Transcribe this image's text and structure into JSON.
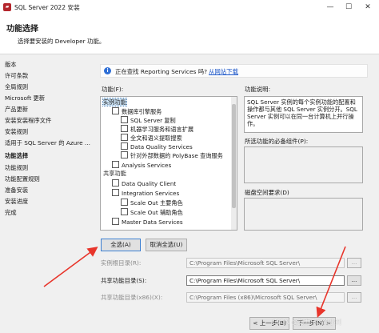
{
  "window": {
    "title": "SQL Server 2022 安装",
    "minimize": "—",
    "maximize": "☐",
    "close": "✕",
    "app_icon": "sql-server-icon"
  },
  "header": {
    "title": "功能选择",
    "subtitle": "选择要安装的 Developer 功能。"
  },
  "sidebar": {
    "items": [
      {
        "label": "版本",
        "active": false
      },
      {
        "label": "许可条款",
        "active": false
      },
      {
        "label": "全局规则",
        "active": false
      },
      {
        "label": "Microsoft 更新",
        "active": false
      },
      {
        "label": "产品更新",
        "active": false
      },
      {
        "label": "安装安装程序文件",
        "active": false
      },
      {
        "label": "安装规则",
        "active": false
      },
      {
        "label": "适用于 SQL Server 的 Azure ...",
        "active": false
      },
      {
        "label": "功能选择",
        "active": true
      },
      {
        "label": "功能规则",
        "active": false
      },
      {
        "label": "功能配置规则",
        "active": false
      },
      {
        "label": "准备安装",
        "active": false
      },
      {
        "label": "安装进度",
        "active": false
      },
      {
        "label": "完成",
        "active": false
      }
    ]
  },
  "info_bar": {
    "icon": "info-icon",
    "text": "正在查找 Reporting Services 吗?",
    "link": "从网站下载"
  },
  "features": {
    "label": "功能(F):",
    "tree": [
      {
        "label": "实例功能",
        "level": 0,
        "checkbox": false,
        "selected": true
      },
      {
        "label": "数据库引擎服务",
        "level": 1,
        "checkbox": true,
        "selected": false
      },
      {
        "label": "SQL Server 复制",
        "level": 2,
        "checkbox": true,
        "selected": false
      },
      {
        "label": "机器学习服务和语言扩展",
        "level": 2,
        "checkbox": true,
        "selected": false
      },
      {
        "label": "全文和语义提取搜索",
        "level": 2,
        "checkbox": true,
        "selected": false
      },
      {
        "label": "Data Quality Services",
        "level": 2,
        "checkbox": true,
        "selected": false
      },
      {
        "label": "针对外部数据的 PolyBase 查询服务",
        "level": 2,
        "checkbox": true,
        "selected": false
      },
      {
        "label": "Analysis Services",
        "level": 1,
        "checkbox": true,
        "selected": false
      },
      {
        "label": "共享功能",
        "level": 0,
        "checkbox": false,
        "selected": false
      },
      {
        "label": "Data Quality Client",
        "level": 1,
        "checkbox": true,
        "selected": false
      },
      {
        "label": "Integration Services",
        "level": 1,
        "checkbox": true,
        "selected": false
      },
      {
        "label": "Scale Out 主要角色",
        "level": 2,
        "checkbox": true,
        "selected": false
      },
      {
        "label": "Scale Out 辅助角色",
        "level": 2,
        "checkbox": true,
        "selected": false
      },
      {
        "label": "Master Data Services",
        "level": 1,
        "checkbox": true,
        "selected": false
      }
    ]
  },
  "description": {
    "label": "功能说明:",
    "text": "SQL Server 实例的每个实例功能的配置和操作都与其他 SQL Server 实例分开。SQL Server 实例可以在同一台计算机上并行操作。"
  },
  "prereq": {
    "label": "所选功能的必备组件(P):"
  },
  "disk": {
    "label": "磁盘空间要求(D)"
  },
  "buttons": {
    "select_all": "全选(A)",
    "unselect_all": "取消全选(U)"
  },
  "paths": {
    "instance_root": {
      "label": "实例根目录(R):",
      "value": "C:\\Program Files\\Microsoft SQL Server\\",
      "enabled": false
    },
    "shared": {
      "label": "共享功能目录(S):",
      "value": "C:\\Program Files\\Microsoft SQL Server\\",
      "enabled": true
    },
    "shared_x86": {
      "label": "共享功能目录(x86)(X):",
      "value": "C:\\Program Files (x86)\\Microsoft SQL Server\\",
      "enabled": false
    },
    "browse": "..."
  },
  "nav_buttons": {
    "back": "< 上一步(B)",
    "next": "下一步(N) >"
  },
  "watermark": "CSDN @努力学习的小刘"
}
